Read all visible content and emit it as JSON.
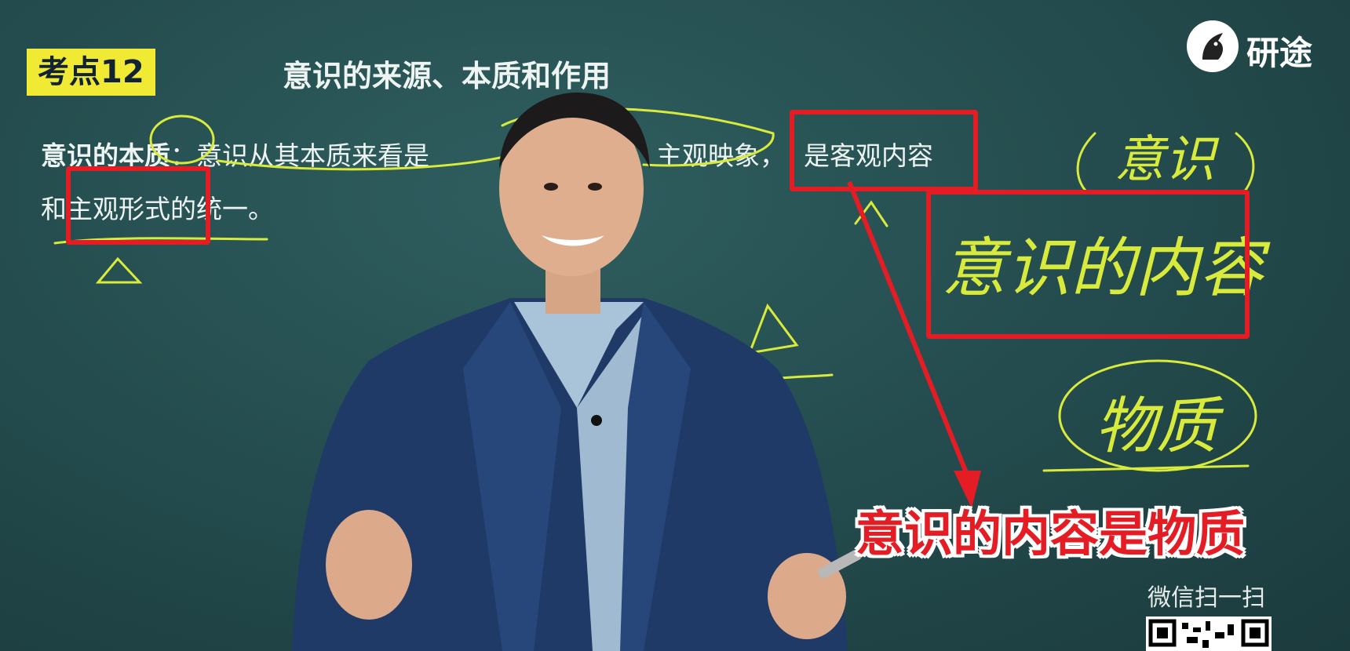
{
  "logo": {
    "icon": "unicorn-logo-icon",
    "text": "研途"
  },
  "tag": {
    "label": "考点12"
  },
  "title": "意识的来源、本质和作用",
  "definition": {
    "line1_term": "意识的本质",
    "line1_part1": "：意识从其本质来看是",
    "line1_part2": "主观映象，",
    "line1_part3": "是客观内容",
    "line2_part1": "和",
    "line2_part2": "主观形式",
    "line2_part3": "的统一。"
  },
  "handwriting": {
    "top": "意识",
    "middle": "意识的内容",
    "bottom": "物质"
  },
  "caption": "意识的内容是物质",
  "wechat": {
    "label": "微信扫一扫",
    "qr": "qr-code-icon"
  },
  "colors": {
    "board": "#234a4c",
    "highlight_tag": "#f1ea35",
    "annotation_red": "#e41d24",
    "chalk_yellow": "#d8ea3c"
  }
}
